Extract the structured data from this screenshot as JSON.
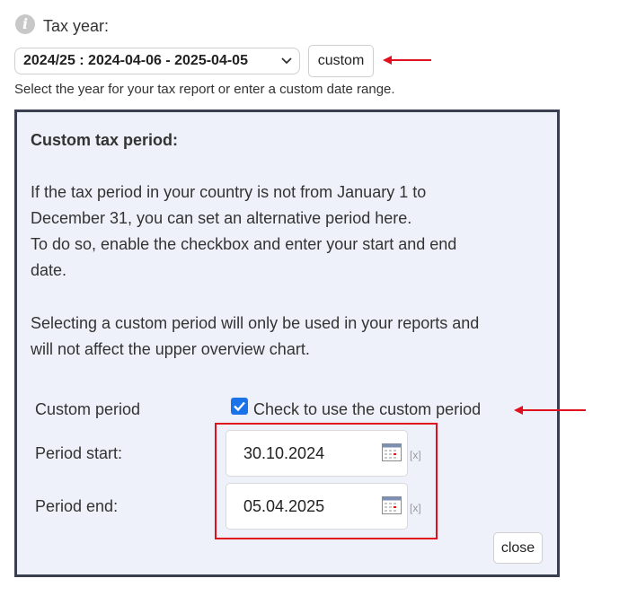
{
  "tax_year": {
    "label": "Tax year:",
    "selected": "2024/25 : 2024-04-06 - 2025-04-05",
    "custom_button": "custom",
    "helper_text": "Select the year for your tax report or enter a custom date range."
  },
  "custom_panel": {
    "title": "Custom tax period:",
    "description_lines": [
      "If the tax period in your country is not from January 1 to",
      "December 31, you can set an alternative period here.",
      "To do so, enable the checkbox and enter your start and end",
      "date."
    ],
    "note_lines": [
      "Selecting a custom period will only be used in your reports and",
      "will not affect the upper overview chart."
    ],
    "custom_period": {
      "label": "Custom period",
      "checked": true,
      "checkbox_label": "Check to use the custom period"
    },
    "period_start": {
      "label": "Period start:",
      "value": "30.10.2024",
      "clear": "[x]"
    },
    "period_end": {
      "label": "Period end:",
      "value": "05.04.2025",
      "clear": "[x]"
    },
    "close_button": "close"
  },
  "icons": [
    "info-icon",
    "chevron-down-icon",
    "calendar-icon",
    "red-arrow-annotation"
  ],
  "colors": {
    "annotation_red": "#e0101e",
    "checkbox_blue": "#1a73e8",
    "panel_border": "#3a3f4f",
    "panel_bg": "#eef1f9"
  }
}
